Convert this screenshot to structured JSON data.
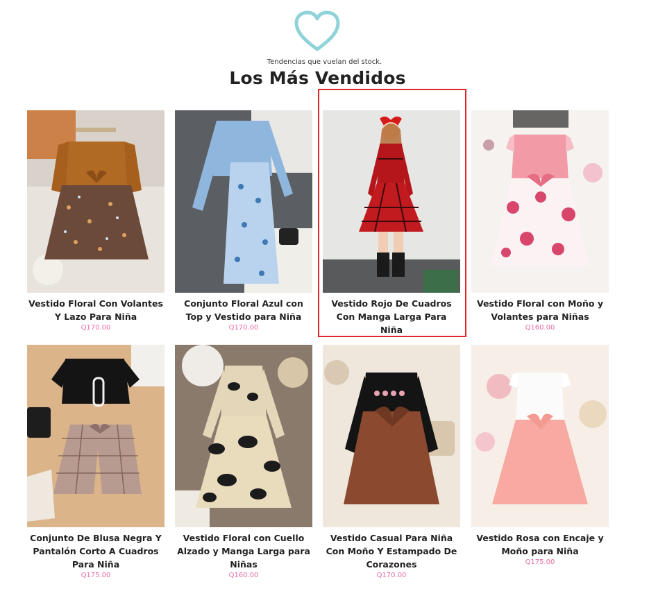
{
  "header": {
    "icon": "heart-icon",
    "tagline": "Tendencias que vuelan del stock.",
    "title": "Los Más Vendidos"
  },
  "colors": {
    "heart": "#8fd3d9",
    "price": "#e66ca6",
    "highlight": "#e0262a"
  },
  "products": [
    {
      "name": "Vestido Floral Con Volantes Y Lazo Para Niña",
      "price": "Q170.00"
    },
    {
      "name": "Conjunto Floral Azul con Top y Vestido para Niña",
      "price": "Q170.00"
    },
    {
      "name": "Vestido Rojo De Cuadros Con Manga Larga Para Niña",
      "price": ""
    },
    {
      "name": "Vestido Floral con Moño y Volantes para Niñas",
      "price": "Q160.00"
    },
    {
      "name": "Conjunto De Blusa Negra Y Pantalón Corto A Cuadros Para Niña",
      "price": "Q175.00"
    },
    {
      "name": "Vestido Floral con Cuello Alzado y Manga Larga para Niñas",
      "price": "Q160.00"
    },
    {
      "name": "Vestido Casual Para Niña Con Moño Y Estampado De Corazones",
      "price": "Q170.00"
    },
    {
      "name": "Vestido Rosa con Encaje y Moño para Niña",
      "price": "Q175.00"
    }
  ]
}
